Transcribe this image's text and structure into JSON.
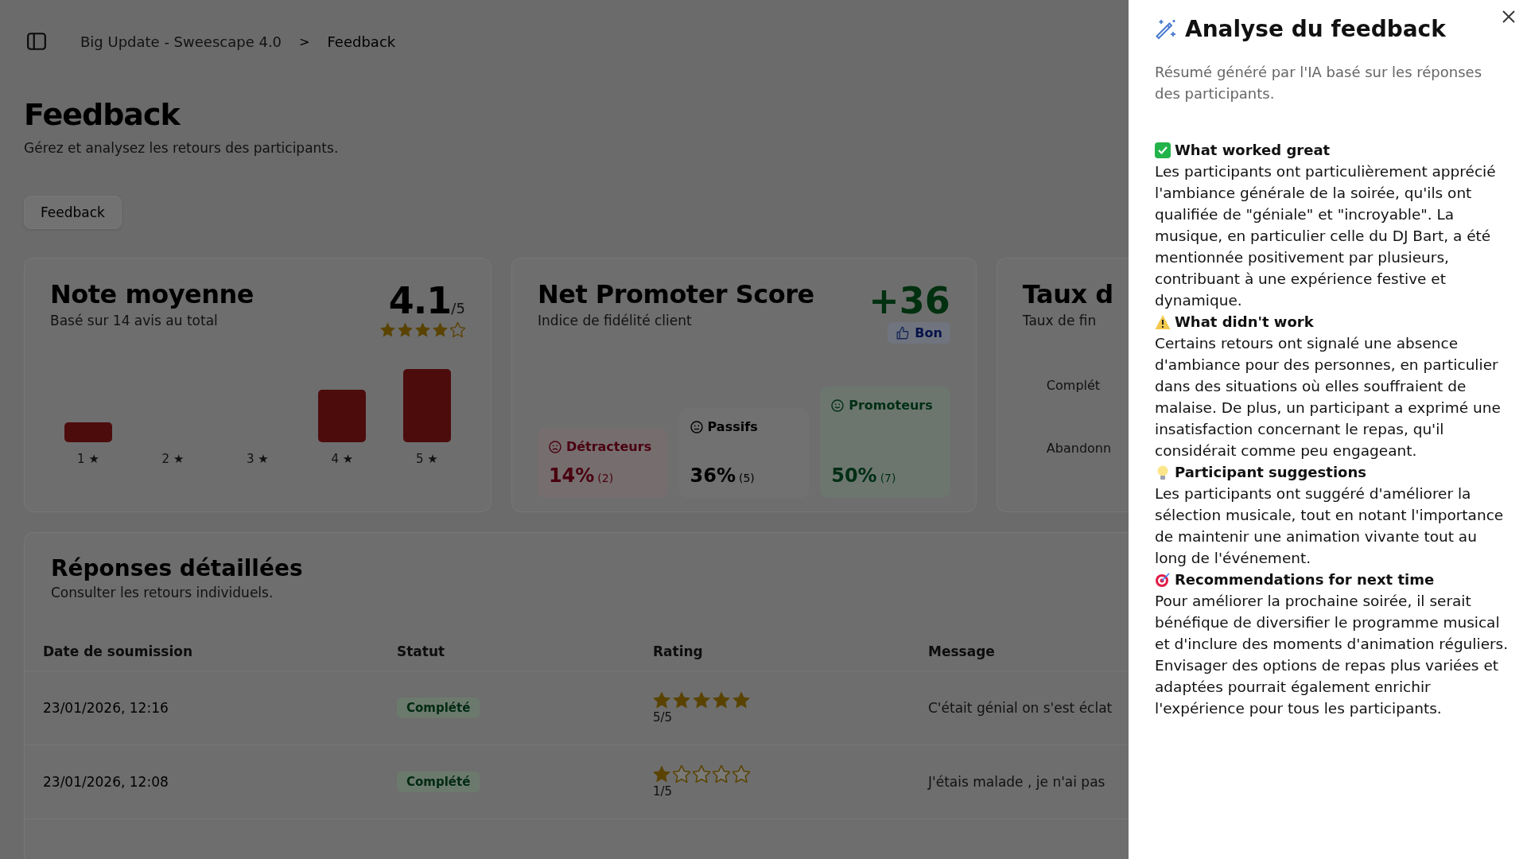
{
  "breadcrumb": [
    {
      "label": "Big Update - Sweescape 4.0",
      "current": false
    },
    {
      "label": "Feedback",
      "current": true
    }
  ],
  "breadcrumb_separator": ">",
  "page": {
    "title": "Feedback",
    "subtitle": "Gérez et analysez les retours des participants."
  },
  "tabs": [
    {
      "label": "Feedback",
      "selected": true
    }
  ],
  "rating_card": {
    "title": "Note moyenne",
    "subtitle": "Basé sur 14 avis au total",
    "score": "4.1",
    "scale": "/5",
    "stars": 4,
    "bar_labels": [
      "1 ★",
      "2 ★",
      "3 ★",
      "4 ★",
      "5 ★"
    ]
  },
  "nps_card": {
    "title": "Net Promoter Score",
    "subtitle": "Indice de fidélité client",
    "score": "+36",
    "badge": "Bon",
    "segments": [
      {
        "kind": "detractors",
        "label": "Détracteurs",
        "percent": "14%",
        "count": "(2)",
        "color": "#4a0010"
      },
      {
        "kind": "passives",
        "label": "Passifs",
        "percent": "36%",
        "count": "(5)",
        "color": "#000000"
      },
      {
        "kind": "promoters",
        "label": "Promoteurs",
        "percent": "50%",
        "count": "(7)",
        "color": "#002e14"
      }
    ]
  },
  "completion_card": {
    "title": "Taux d",
    "subtitle": "Taux de fin",
    "rows": [
      "Complét",
      "Abandonn"
    ]
  },
  "responses": {
    "title": "Réponses détaillées",
    "subtitle": "Consulter les retours individuels.",
    "columns": [
      "Date de soumission",
      "Statut",
      "Rating",
      "Message"
    ],
    "rows": [
      {
        "date": "23/01/2026, 12:16",
        "status": "Complété",
        "stars": 5,
        "rating": "5/5",
        "message": "C'était génial on s'est éclat"
      },
      {
        "date": "23/01/2026, 12:08",
        "status": "Complété",
        "stars": 1,
        "rating": "1/5",
        "message": "J'étais malade , je n'ai pas"
      }
    ]
  },
  "panel": {
    "title": "Analyse du feedback",
    "subtitle": "Résumé généré par l'IA basé sur les réponses des participants.",
    "sections": [
      {
        "kind": "worked",
        "heading": "What worked great",
        "text": "Les participants ont particulièrement apprécié l'ambiance générale de la soirée, qu'ils ont qualifiée de \"géniale\" et \"incroyable\". La musique, en particulier celle du DJ Bart, a été mentionnée positivement par plusieurs, contribuant à une expérience festive et dynamique."
      },
      {
        "kind": "issues",
        "heading": "What didn't work",
        "text": "Certains retours ont signalé une absence d'ambiance pour des personnes, en particulier dans des situations où elles souffraient de malaise. De plus, un participant a exprimé une insatisfaction concernant le repas, qu'il considérait comme peu engageant."
      },
      {
        "kind": "suggestions",
        "heading": "Participant suggestions",
        "text": "Les participants ont suggéré d'améliorer la sélection musicale, tout en notant l'importance de maintenir une animation vivante tout au long de l'événement."
      },
      {
        "kind": "recommendations",
        "heading": "Recommendations for next time",
        "text": "Pour améliorer la prochaine soirée, il serait bénéfique de diversifier le programme musical et d'inclure des moments d'animation réguliers. Envisager des options de repas plus variées et adaptées pourrait également enrichir l'expérience pour tous les participants."
      }
    ]
  }
}
